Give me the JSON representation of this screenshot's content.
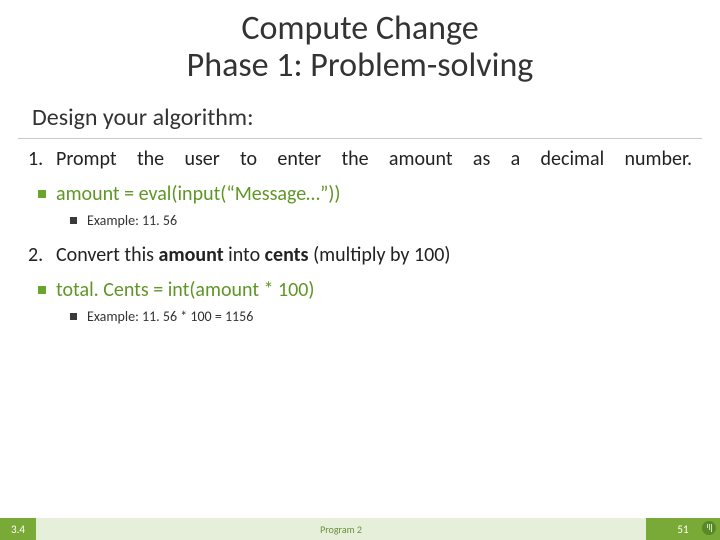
{
  "title": {
    "line1": "Compute Change",
    "line2": "Phase 1: Problem-solving"
  },
  "heading": "Design your algorithm:",
  "steps": [
    {
      "num": "1.",
      "text": "Prompt the user to enter the amount as a decimal number.",
      "code": "amount = eval(input(“Message…”))",
      "example": "Example: 11. 56"
    },
    {
      "num": "2.",
      "text_prefix": "Convert this ",
      "text_bold1": "amount",
      "text_mid": " into ",
      "text_bold2": "cents",
      "text_suffix": " (multiply by 100)",
      "code": "total. Cents = int(amount * 100)",
      "example": "Example: 11. 56 * 100 = 1156"
    }
  ],
  "footer": {
    "left": "3.4",
    "mid": "Program 2",
    "right": "51"
  }
}
